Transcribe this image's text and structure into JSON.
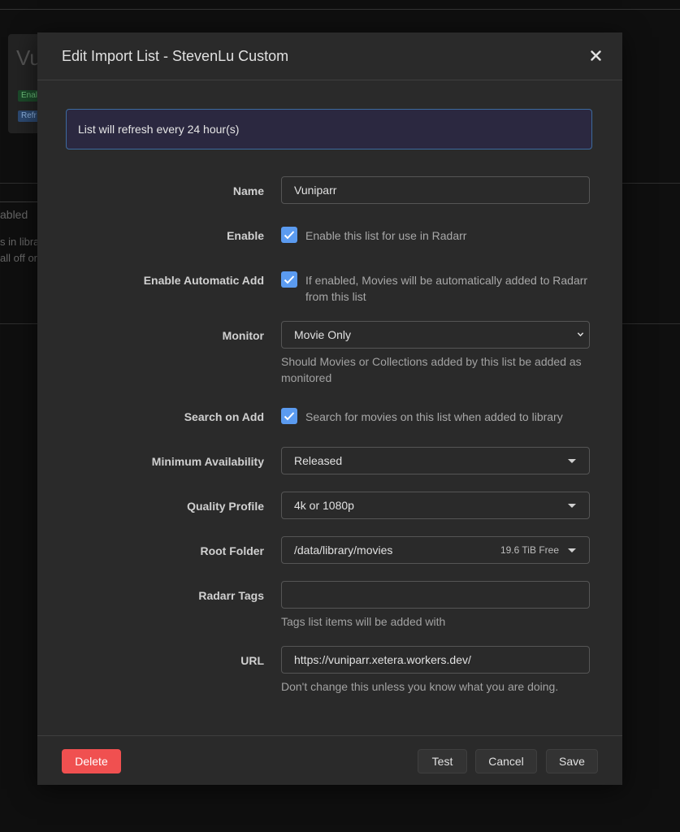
{
  "background": {
    "card_title": "Vu",
    "tag_enabled": "Enal",
    "tag_refresh": "Refr",
    "col_header": "abled",
    "row_text_1": "s in libra",
    "row_text_2": "all off or"
  },
  "modal": {
    "title": "Edit Import List - StevenLu Custom",
    "info": "List will refresh every 24 hour(s)"
  },
  "fields": {
    "name": {
      "label": "Name",
      "value": "Vuniparr"
    },
    "enable": {
      "label": "Enable",
      "checked": true,
      "text": "Enable this list for use in Radarr"
    },
    "auto_add": {
      "label": "Enable Automatic Add",
      "checked": true,
      "text": "If enabled, Movies will be automatically added to Radarr from this list"
    },
    "monitor": {
      "label": "Monitor",
      "value": "Movie Only",
      "help": "Should Movies or Collections added by this list be added as monitored"
    },
    "search_on_add": {
      "label": "Search on Add",
      "checked": true,
      "text": "Search for movies on this list when added to library"
    },
    "min_availability": {
      "label": "Minimum Availability",
      "value": "Released"
    },
    "quality_profile": {
      "label": "Quality Profile",
      "value": "4k or 1080p"
    },
    "root_folder": {
      "label": "Root Folder",
      "value": "/data/library/movies",
      "free": "19.6 TiB Free"
    },
    "tags": {
      "label": "Radarr Tags",
      "value": "",
      "help": "Tags list items will be added with"
    },
    "url": {
      "label": "URL",
      "value": "https://vuniparr.xetera.workers.dev/",
      "help": "Don't change this unless you know what you are doing."
    }
  },
  "footer": {
    "delete": "Delete",
    "test": "Test",
    "cancel": "Cancel",
    "save": "Save"
  },
  "colors": {
    "danger": "#f05050",
    "checkbox": "#5b9bf0",
    "info_border": "#3d6a9e"
  }
}
